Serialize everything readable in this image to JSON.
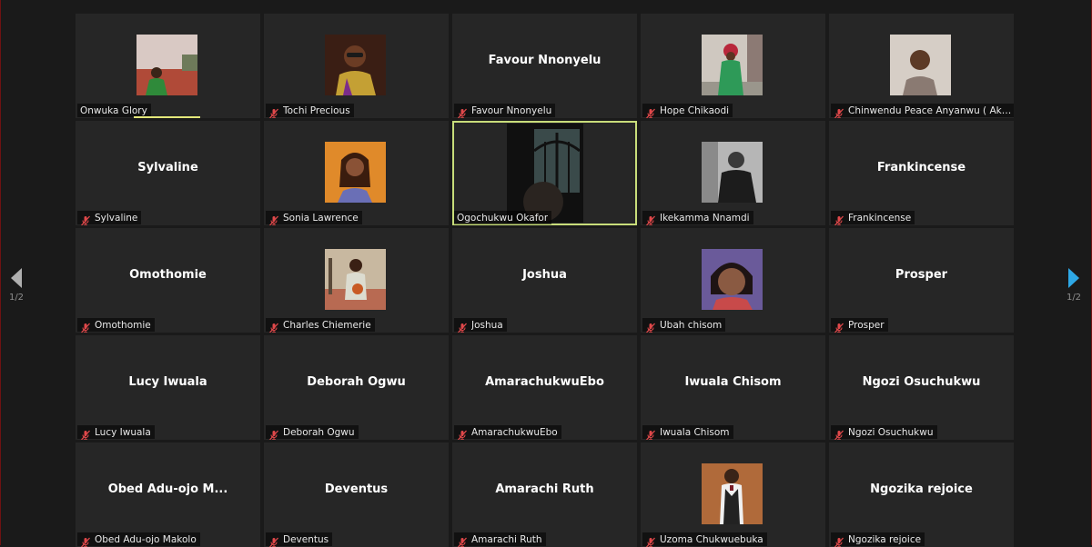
{
  "gallery": {
    "participants": [
      {
        "tile_name": "",
        "label": "Onwuka Glory",
        "muted": false,
        "speaking": true,
        "video": true,
        "image": "girl-outdoor-green-dress"
      },
      {
        "tile_name": "",
        "label": "Tochi Precious",
        "muted": true,
        "video": true,
        "image": "woman-glasses-smiling"
      },
      {
        "tile_name": "Favour Nnonyelu",
        "label": "Favour Nnonyelu",
        "muted": true,
        "video": false
      },
      {
        "tile_name": "",
        "label": "Hope Chikaodi",
        "muted": true,
        "video": true,
        "image": "woman-green-dress-red-headwrap"
      },
      {
        "tile_name": "",
        "label": "Chinwendu Peace Anyanwu ( Akwugo )",
        "muted": true,
        "video": true,
        "image": "woman-indoor"
      },
      {
        "tile_name": "Sylvaline",
        "label": "Sylvaline",
        "muted": true,
        "video": false
      },
      {
        "tile_name": "",
        "label": "Sonia Lawrence",
        "muted": true,
        "video": true,
        "image": "young-woman-braids"
      },
      {
        "tile_name": "",
        "label": "Ogochukwu Okafor",
        "muted": false,
        "active": true,
        "video": true,
        "image": "person-dark-room-window"
      },
      {
        "tile_name": "",
        "label": "Ikekamma Nnamdi",
        "muted": true,
        "video": true,
        "image": "man-black-and-white"
      },
      {
        "tile_name": "Frankincense",
        "label": "Frankincense",
        "muted": true,
        "video": false
      },
      {
        "tile_name": "Omothomie",
        "label": "Omothomie",
        "muted": true,
        "video": false
      },
      {
        "tile_name": "",
        "label": "Charles Chiemerie",
        "muted": true,
        "video": true,
        "image": "man-basketball-court"
      },
      {
        "tile_name": "Joshua",
        "label": "Joshua",
        "muted": true,
        "video": false
      },
      {
        "tile_name": "",
        "label": "Ubah chisom",
        "muted": true,
        "video": true,
        "image": "child-smiling"
      },
      {
        "tile_name": "Prosper",
        "label": "Prosper",
        "muted": true,
        "video": false
      },
      {
        "tile_name": "Lucy Iwuala",
        "label": "Lucy Iwuala",
        "muted": true,
        "video": false
      },
      {
        "tile_name": "Deborah Ogwu",
        "label": "Deborah Ogwu",
        "muted": true,
        "video": false
      },
      {
        "tile_name": "AmarachukwuEbo",
        "label": "AmarachukwuEbo",
        "muted": true,
        "video": false
      },
      {
        "tile_name": "Iwuala Chisom",
        "label": "Iwuala Chisom",
        "muted": true,
        "video": false
      },
      {
        "tile_name": "Ngozi Osuchukwu",
        "label": "Ngozi Osuchukwu",
        "muted": true,
        "video": false
      },
      {
        "tile_name": "Obed Adu-ojo M...",
        "label": "Obed Adu-ojo Makolo",
        "muted": true,
        "video": false
      },
      {
        "tile_name": "Deventus",
        "label": "Deventus",
        "muted": true,
        "video": false
      },
      {
        "tile_name": "Amarachi Ruth",
        "label": "Amarachi Ruth",
        "muted": true,
        "video": false
      },
      {
        "tile_name": "",
        "label": "Uzoma Chukwuebuka",
        "muted": true,
        "video": true,
        "image": "man-suit-vest"
      },
      {
        "tile_name": "Ngozika rejoice",
        "label": "Ngozika rejoice",
        "muted": true,
        "video": false
      }
    ]
  },
  "nav": {
    "prev_page": "1/2",
    "next_page": "1/2",
    "prev_icon": "triangle-left-icon",
    "next_icon": "triangle-right-icon",
    "prev_color": "#b0b0b0",
    "next_color": "#2ea8e6"
  },
  "colors": {
    "tile_bg": "#262626",
    "active_border": "#c8dd7a",
    "speaking_bar": "#e4e87a",
    "muted_mic": "#e0484a"
  }
}
